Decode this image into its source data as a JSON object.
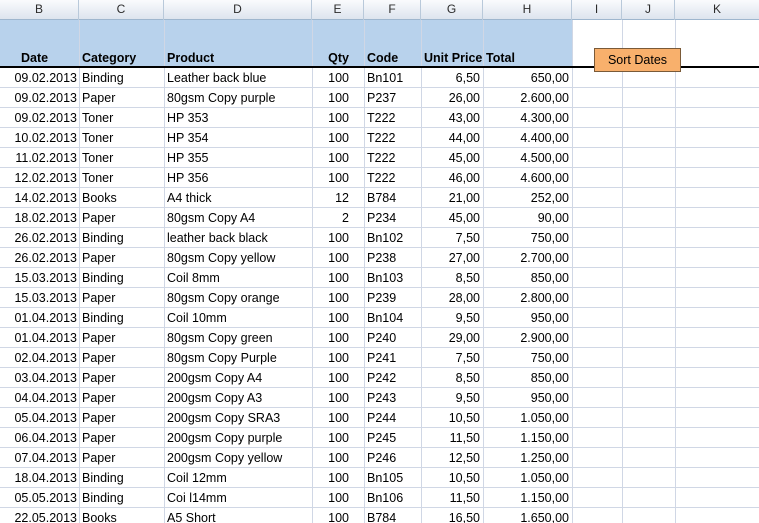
{
  "columns": [
    "B",
    "C",
    "D",
    "E",
    "F",
    "G",
    "H",
    "I",
    "J",
    "K"
  ],
  "table": {
    "headers": {
      "date": "Date",
      "category": "Category",
      "product": "Product",
      "qty": "Qty",
      "code": "Code",
      "unit_price": "Unit Price",
      "total": "Total"
    },
    "rows": [
      {
        "date": "09.02.2013",
        "category": "Binding",
        "product": "Leather back blue",
        "qty": "100",
        "code": "Bn101",
        "unit_price": "6,50",
        "total": "650,00"
      },
      {
        "date": "09.02.2013",
        "category": "Paper",
        "product": "80gsm Copy purple",
        "qty": "100",
        "code": "P237",
        "unit_price": "26,00",
        "total": "2.600,00"
      },
      {
        "date": "09.02.2013",
        "category": "Toner",
        "product": "HP 353",
        "qty": "100",
        "code": "T222",
        "unit_price": "43,00",
        "total": "4.300,00"
      },
      {
        "date": "10.02.2013",
        "category": "Toner",
        "product": "HP 354",
        "qty": "100",
        "code": "T222",
        "unit_price": "44,00",
        "total": "4.400,00"
      },
      {
        "date": "11.02.2013",
        "category": "Toner",
        "product": "HP 355",
        "qty": "100",
        "code": "T222",
        "unit_price": "45,00",
        "total": "4.500,00"
      },
      {
        "date": "12.02.2013",
        "category": "Toner",
        "product": "HP 356",
        "qty": "100",
        "code": "T222",
        "unit_price": "46,00",
        "total": "4.600,00"
      },
      {
        "date": "14.02.2013",
        "category": "Books",
        "product": "A4 thick",
        "qty": "12",
        "code": "B784",
        "unit_price": "21,00",
        "total": "252,00"
      },
      {
        "date": "18.02.2013",
        "category": "Paper",
        "product": "80gsm Copy A4",
        "qty": "2",
        "code": "P234",
        "unit_price": "45,00",
        "total": "90,00"
      },
      {
        "date": "26.02.2013",
        "category": "Binding",
        "product": "leather back black",
        "qty": "100",
        "code": "Bn102",
        "unit_price": "7,50",
        "total": "750,00"
      },
      {
        "date": "26.02.2013",
        "category": "Paper",
        "product": "80gsm Copy yellow",
        "qty": "100",
        "code": "P238",
        "unit_price": "27,00",
        "total": "2.700,00"
      },
      {
        "date": "15.03.2013",
        "category": "Binding",
        "product": "Coil 8mm",
        "qty": "100",
        "code": "Bn103",
        "unit_price": "8,50",
        "total": "850,00"
      },
      {
        "date": "15.03.2013",
        "category": "Paper",
        "product": "80gsm Copy orange",
        "qty": "100",
        "code": "P239",
        "unit_price": "28,00",
        "total": "2.800,00"
      },
      {
        "date": "01.04.2013",
        "category": "Binding",
        "product": "Coil 10mm",
        "qty": "100",
        "code": "Bn104",
        "unit_price": "9,50",
        "total": "950,00"
      },
      {
        "date": "01.04.2013",
        "category": "Paper",
        "product": "80gsm Copy green",
        "qty": "100",
        "code": "P240",
        "unit_price": "29,00",
        "total": "2.900,00"
      },
      {
        "date": "02.04.2013",
        "category": "Paper",
        "product": "80gsm Copy Purple",
        "qty": "100",
        "code": "P241",
        "unit_price": "7,50",
        "total": "750,00"
      },
      {
        "date": "03.04.2013",
        "category": "Paper",
        "product": "200gsm Copy A4",
        "qty": "100",
        "code": "P242",
        "unit_price": "8,50",
        "total": "850,00"
      },
      {
        "date": "04.04.2013",
        "category": "Paper",
        "product": "200gsm Copy A3",
        "qty": "100",
        "code": "P243",
        "unit_price": "9,50",
        "total": "950,00"
      },
      {
        "date": "05.04.2013",
        "category": "Paper",
        "product": "200gsm Copy SRA3",
        "qty": "100",
        "code": "P244",
        "unit_price": "10,50",
        "total": "1.050,00"
      },
      {
        "date": "06.04.2013",
        "category": "Paper",
        "product": "200gsm Copy purple",
        "qty": "100",
        "code": "P245",
        "unit_price": "11,50",
        "total": "1.150,00"
      },
      {
        "date": "07.04.2013",
        "category": "Paper",
        "product": "200gsm Copy yellow",
        "qty": "100",
        "code": "P246",
        "unit_price": "12,50",
        "total": "1.250,00"
      },
      {
        "date": "18.04.2013",
        "category": "Binding",
        "product": "Coil 12mm",
        "qty": "100",
        "code": "Bn105",
        "unit_price": "10,50",
        "total": "1.050,00"
      },
      {
        "date": "05.05.2013",
        "category": "Binding",
        "product": "Coi l14mm",
        "qty": "100",
        "code": "Bn106",
        "unit_price": "11,50",
        "total": "1.150,00"
      },
      {
        "date": "22.05.2013",
        "category": "Books",
        "product": "A5 Short",
        "qty": "100",
        "code": "B784",
        "unit_price": "16,50",
        "total": "1.650,00"
      }
    ]
  },
  "sort_button": {
    "label": "Sort Dates"
  },
  "colors": {
    "header_band": "#b8d2ec",
    "button": "#f8b06c",
    "gridline": "#d0d7e5"
  }
}
